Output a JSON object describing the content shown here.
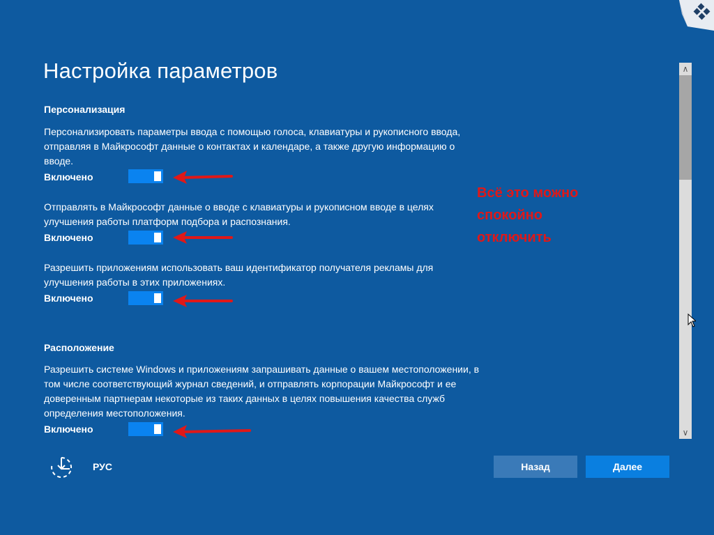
{
  "title": "Настройка параметров",
  "sections": {
    "personalization": {
      "heading": "Персонализация",
      "settings": [
        {
          "description_lines": [
            "Персонализировать параметры ввода с помощью голоса, клавиатуры и рукописного ввода,",
            "отправляя в Майкрософт данные о контактах и календаре, а также другую информацию о",
            "вводе."
          ],
          "state_label": "Включено",
          "enabled": true
        },
        {
          "description_lines": [
            "Отправлять в Майкрософт данные о вводе с клавиатуры и рукописном вводе в целях",
            "улучшения работы платформ подбора и распознания."
          ],
          "state_label": "Включено",
          "enabled": true
        },
        {
          "description_lines": [
            "Разрешить приложениям использовать ваш идентификатор получателя рекламы для",
            "улучшения работы в этих приложениях."
          ],
          "state_label": "Включено",
          "enabled": true
        }
      ]
    },
    "location": {
      "heading": "Расположение",
      "settings": [
        {
          "description_lines": [
            "Разрешить системе Windows и приложениям запрашивать данные о вашем местоположении, в",
            "том числе соответствующий журнал сведений, и отправлять корпорации Майкрософт и ее",
            "доверенным партнерам некоторые из таких данных в целях повышения качества служб",
            "определения местоположения."
          ],
          "state_label": "Включено",
          "enabled": true
        }
      ]
    }
  },
  "annotation": {
    "lines": [
      "Всё это можно",
      "спокойно",
      "отключить"
    ],
    "color": "#e01818"
  },
  "footer": {
    "accessibility_icon": "ease-of-access-icon",
    "language": "РУС",
    "back_label": "Назад",
    "next_label": "Далее"
  },
  "colors": {
    "background": "#0e5aa0",
    "toggle_on": "#0a83f0",
    "next_button": "#0a7fe0",
    "back_button": "#3a7ab8",
    "arrow": "#e01818"
  }
}
